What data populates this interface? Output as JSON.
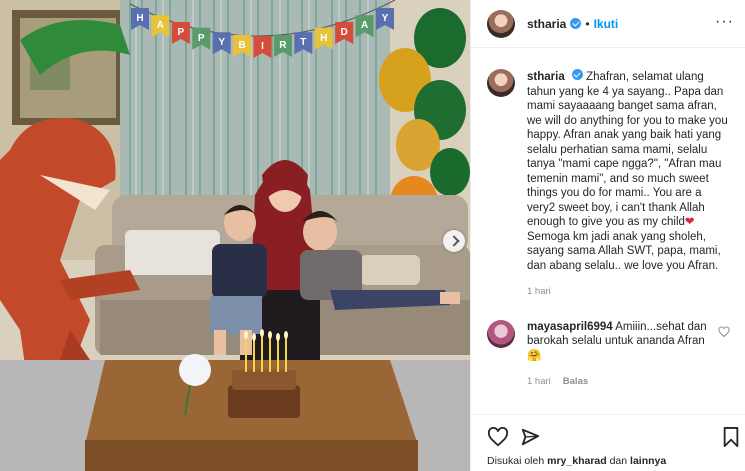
{
  "post": {
    "username": "stharia",
    "follow_label": "Ikuti",
    "separator": "•",
    "more_label": "···",
    "banner_letters": [
      "H",
      "A",
      "P",
      "P",
      "Y",
      "B",
      "I",
      "R",
      "T",
      "H",
      "D",
      "A",
      "Y"
    ]
  },
  "caption": {
    "username": "stharia",
    "text": "Zhafran, selamat ulang tahun yang ke 4 ya sayang.. Papa dan mami sayaaaang banget sama afran, we will do anything for you to make you happy. Afran anak yang baik hati yang selalu perhatian sama mami, selalu tanya \"mami cape ngga?\", \"Afran mau temenin mami\", and so much sweet things you do for mami.. You are a very2 sweet boy, i can't thank Allah enough to give you as my child",
    "heart": "❤",
    "text_after": " Semoga km jadi anak yang sholeh, sayang sama Allah SWT, papa, mami, dan abang selalu.. we love you Afran.",
    "time": "1 hari"
  },
  "comment": {
    "username": "mayasapril6994",
    "text": "Amiiin...sehat dan barokah selalu untuk ananda Afran",
    "emoji": "🤗",
    "time": "1 hari",
    "reply_label": "Balas"
  },
  "likes": {
    "prefix": "Disukai oleh",
    "user": "mry_kharad",
    "conjunction": "dan",
    "others": "lainnya"
  },
  "colors": {
    "accent": "#0095f6",
    "verified": "#3897f0",
    "heart": "#e0243e"
  },
  "icons": [
    "heart-icon",
    "comment-icon",
    "share-icon",
    "bookmark-icon",
    "verified-icon",
    "chevron-right-icon"
  ]
}
